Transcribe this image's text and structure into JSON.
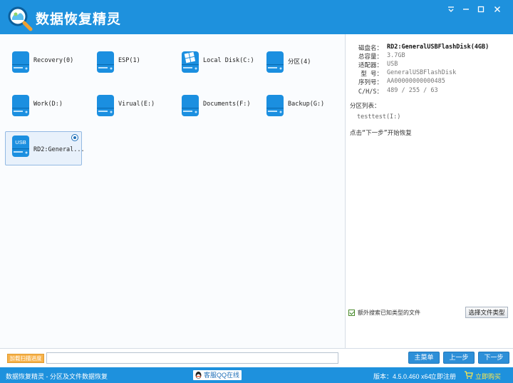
{
  "app": {
    "title": "数据恢复精灵",
    "window_controls": {
      "menu_icon": "menu-icon",
      "minimize_icon": "minimize-icon",
      "maximize_icon": "maximize-icon",
      "close_icon": "close-icon"
    }
  },
  "drives": [
    {
      "label": "Recovery(0)",
      "type": "disk",
      "selected": false
    },
    {
      "label": "ESP(1)",
      "type": "disk",
      "selected": false
    },
    {
      "label": "Local Disk(C:)",
      "type": "windows-disk",
      "selected": false
    },
    {
      "label": "分区(4)",
      "type": "disk",
      "selected": false
    },
    {
      "label": "Work(D:)",
      "type": "disk",
      "selected": false
    },
    {
      "label": "Virual(E:)",
      "type": "disk",
      "selected": false
    },
    {
      "label": "Documents(F:)",
      "type": "disk",
      "selected": false
    },
    {
      "label": "Backup(G:)",
      "type": "disk",
      "selected": false
    },
    {
      "label": "RD2:General...",
      "type": "usb",
      "usb_text": "USB",
      "selected": true
    }
  ],
  "info": {
    "rows": [
      {
        "key": "磁盘名：",
        "value": "RD2:GeneralUSBFlashDisk(4GB)",
        "strong": true
      },
      {
        "key": "总容量：",
        "value": "3.7GB"
      },
      {
        "key": "适配器：",
        "value": "USB"
      },
      {
        "key": "型 号：",
        "value": "GeneralUSBFlashDisk"
      },
      {
        "key": "序列号：",
        "value": "AA00000000000485"
      },
      {
        "key": "C/H/S：",
        "value": "489 / 255 / 63"
      }
    ],
    "partition_list_label": "分区列表：",
    "partitions": [
      "testtest(I:)"
    ],
    "hint": "点击“下一步”开始恢复",
    "extra_search_label": "额外搜索已知类型的文件",
    "extra_search_checked": true,
    "select_type_button": "选择文件类型"
  },
  "actionbar": {
    "load_progress_button": "加载扫描进度",
    "path_value": "",
    "main_menu_button": "主菜单",
    "prev_button": "上一步",
    "next_button": "下一步"
  },
  "statusbar": {
    "left_text": "数据恢复精灵 - 分区及文件数据恢复",
    "qq_text": "客服QQ在线",
    "version_text": "版本：4.5.0.460 x64",
    "register_text": "立即注册",
    "buy_text": "立即购买"
  },
  "colors": {
    "accent": "#1e91dd",
    "disk_blue": "#1b8fe0",
    "buy_yellow": "#ffe94a",
    "load_orange": "#f7b24a"
  }
}
